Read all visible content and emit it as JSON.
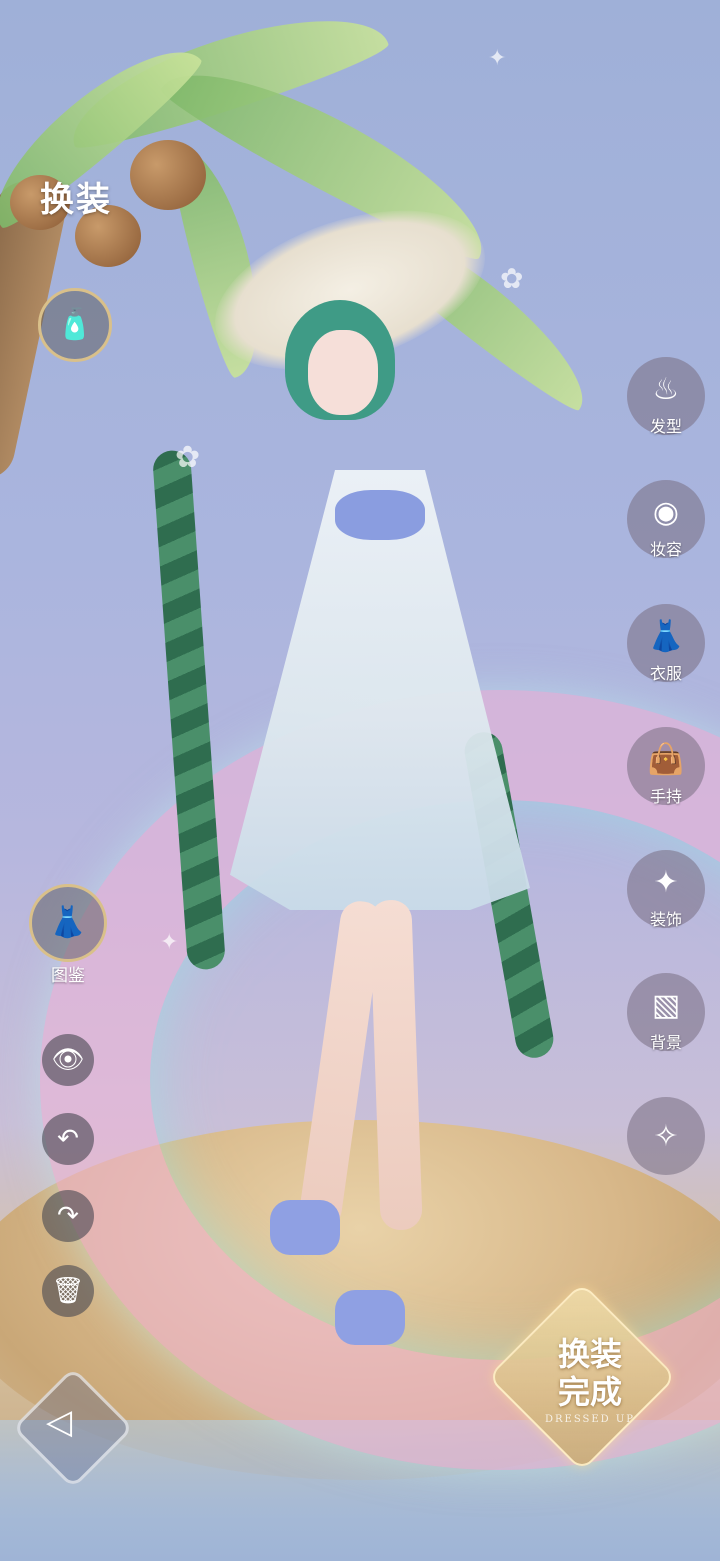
{
  "header": {
    "title": "换装"
  },
  "sidebar_right": {
    "items": [
      {
        "label": "发型",
        "icon": "hairstyle-icon",
        "glyph": "♨"
      },
      {
        "label": "妆容",
        "icon": "makeup-icon",
        "glyph": "◉"
      },
      {
        "label": "衣服",
        "icon": "dress-icon",
        "glyph": "👗"
      },
      {
        "label": "手持",
        "icon": "handbag-icon",
        "glyph": "👜"
      },
      {
        "label": "装饰",
        "icon": "wings-icon",
        "glyph": "✦"
      },
      {
        "label": "背景",
        "icon": "background-icon",
        "glyph": "▧"
      },
      {
        "label": "",
        "icon": "outfit-set-icon",
        "glyph": "✧"
      }
    ]
  },
  "left_tools": {
    "beauty_icon": "bottle-icon",
    "gallery_label": "图鉴",
    "gallery_icon": "gown-icon",
    "eye": "👁",
    "undo": "↶",
    "redo": "↷",
    "delete": "🗑"
  },
  "confirm": {
    "line1": "换装",
    "line2": "完成",
    "sub": "DRESSED UP"
  },
  "back": {
    "glyph": "◁"
  }
}
